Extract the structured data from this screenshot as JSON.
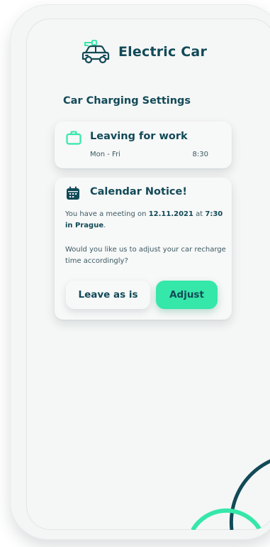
{
  "app": {
    "title": "Electric Car",
    "car_icon": "electric-car-icon"
  },
  "section": {
    "title": "Car Charging Settings"
  },
  "work_card": {
    "icon": "briefcase-icon",
    "title": "Leaving for work",
    "days": "Mon - Fri",
    "time": "8:30"
  },
  "notice_card": {
    "icon": "calendar-icon",
    "title": "Calendar Notice!",
    "message_prefix": "You have a meeting on ",
    "message_date": "12.11.2021",
    "message_mid": " at ",
    "message_time_place": "7:30 in Prague",
    "message_suffix": ".",
    "question": "Would you like us to adjust your car recharge time accordingly?",
    "leave_button": "Leave as is",
    "adjust_button": "Adjust"
  },
  "colors": {
    "primary_text": "#124a57",
    "accent": "#35e7a9",
    "background": "#f5f6f6"
  }
}
